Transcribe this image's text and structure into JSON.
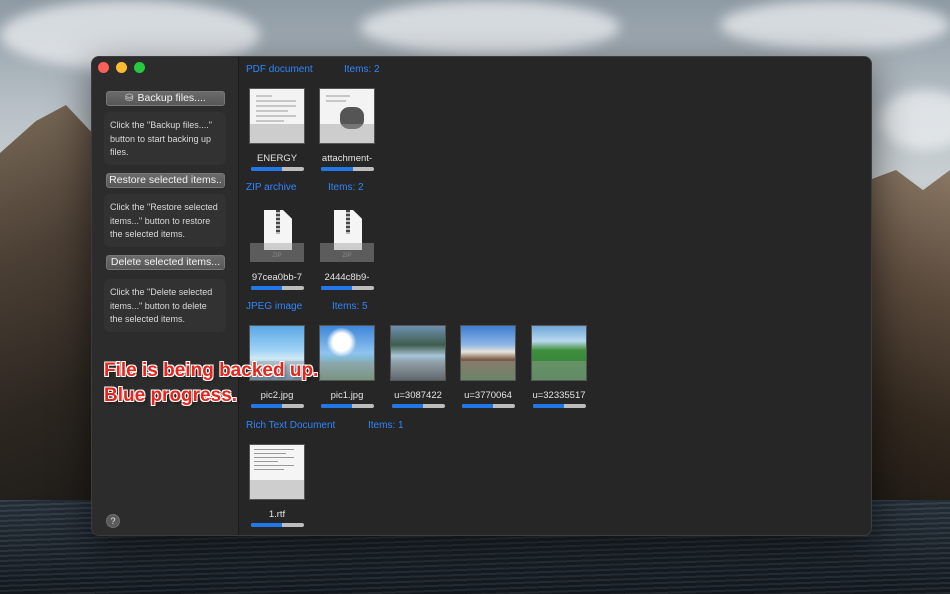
{
  "sidebar": {
    "backup_button": "Backup files....",
    "backup_desc": "Click the \"Backup files....\" button to start backing up files.",
    "restore_button": "Restore selected items..",
    "restore_desc": "Click the \"Restore selected items...\" button to restore the selected items.",
    "delete_button": "Delete selected items...",
    "delete_desc": "Click the \"Delete selected items...\" button to delete the selected items.",
    "help_label": "?"
  },
  "groups": [
    {
      "type": "PDF document",
      "count": "Items: 2",
      "items": [
        {
          "label": "ENERGY",
          "progress": 0.58,
          "icon": "pdf-page"
        },
        {
          "label": "attachment-",
          "progress": 0.6,
          "icon": "pdf-page"
        }
      ]
    },
    {
      "type": "ZIP archive",
      "count": "Items: 2",
      "items": [
        {
          "label": "97cea0bb-7",
          "progress": 0.58,
          "icon": "zip-file"
        },
        {
          "label": "2444c8b9-",
          "progress": 0.58,
          "icon": "zip-file"
        }
      ]
    },
    {
      "type": "JPEG image",
      "count": "Items: 5",
      "items": [
        {
          "label": "pic2.jpg",
          "progress": 0.58,
          "icon": "image"
        },
        {
          "label": "pic1.jpg",
          "progress": 0.58,
          "icon": "image"
        },
        {
          "label": "u=3087422",
          "progress": 0.58,
          "icon": "image"
        },
        {
          "label": "u=3770064",
          "progress": 0.58,
          "icon": "image"
        },
        {
          "label": "u=32335517",
          "progress": 0.58,
          "icon": "image"
        }
      ]
    },
    {
      "type": "Rich Text Document",
      "count": "Items: 1",
      "items": [
        {
          "label": "1.rtf",
          "progress": 0.58,
          "icon": "rtf-page"
        }
      ]
    }
  ],
  "annotation": {
    "line1": "File is being backed up.",
    "line2": "Blue progress."
  },
  "colors": {
    "accent": "#2f86ff",
    "progress_fill": "#2277e8",
    "annotation": "#e8241b"
  }
}
